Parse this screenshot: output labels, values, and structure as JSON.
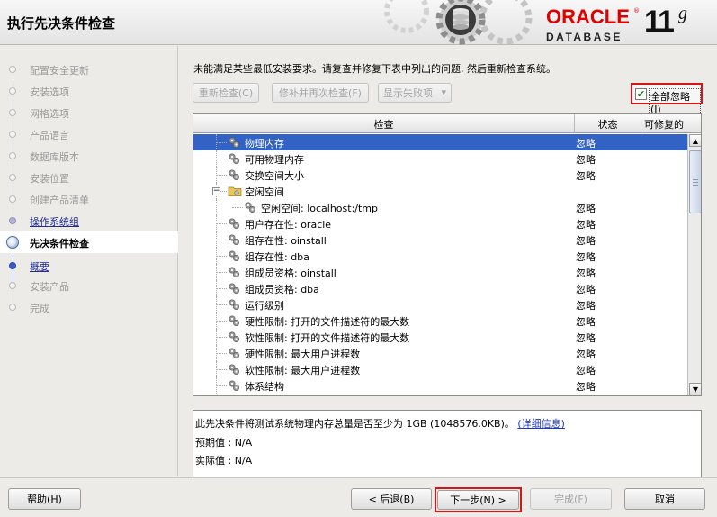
{
  "window": {
    "title": "执行先决条件检查"
  },
  "branding": {
    "oracle": "ORACLE",
    "registered": "®",
    "database": "DATABASE",
    "version": "11",
    "version_suffix": "g"
  },
  "sidebar": {
    "steps": [
      {
        "label": "配置安全更新",
        "state": "pending"
      },
      {
        "label": "安装选项",
        "state": "pending"
      },
      {
        "label": "网格选项",
        "state": "pending"
      },
      {
        "label": "产品语言",
        "state": "pending"
      },
      {
        "label": "数据库版本",
        "state": "pending"
      },
      {
        "label": "安装位置",
        "state": "pending"
      },
      {
        "label": "创建产品清单",
        "state": "pending"
      },
      {
        "label": "操作系统组",
        "state": "done"
      },
      {
        "label": "先决条件检查",
        "state": "current"
      },
      {
        "label": "概要",
        "state": "next"
      },
      {
        "label": "安装产品",
        "state": "pending"
      },
      {
        "label": "完成",
        "state": "pending"
      }
    ]
  },
  "main": {
    "instruction": "未能满足某些最低安装要求。请复查并修复下表中列出的问题, 然后重新检查系统。",
    "toolbar": {
      "recheck": "重新检查(C)",
      "fix_and_check": "修补并再次检查(F)",
      "show_failed": "显示失败项",
      "dropdown_arrow": "▾"
    },
    "ignore_all": {
      "label": "全部忽略(I)",
      "checked": true,
      "checkmark": "✔"
    },
    "table": {
      "columns": [
        "检查",
        "状态",
        "可修复的"
      ],
      "rows": [
        {
          "label": "物理内存",
          "status": "忽略",
          "level": 1,
          "icon": "gear-icon",
          "selected": true
        },
        {
          "label": "可用物理内存",
          "status": "忽略",
          "level": 1,
          "icon": "gear-icon"
        },
        {
          "label": "交换空间大小",
          "status": "忽略",
          "level": 1,
          "icon": "gear-icon"
        },
        {
          "label": "空闲空间",
          "status": "",
          "level": 1,
          "icon": "folder-icon",
          "expanded": true
        },
        {
          "label": "空闲空间: localhost:/tmp",
          "status": "忽略",
          "level": 2,
          "icon": "gear-icon"
        },
        {
          "label": "用户存在性: oracle",
          "status": "忽略",
          "level": 1,
          "icon": "gear-icon"
        },
        {
          "label": "组存在性: oinstall",
          "status": "忽略",
          "level": 1,
          "icon": "gear-icon"
        },
        {
          "label": "组存在性: dba",
          "status": "忽略",
          "level": 1,
          "icon": "gear-icon"
        },
        {
          "label": "组成员资格: oinstall",
          "status": "忽略",
          "level": 1,
          "icon": "gear-icon"
        },
        {
          "label": "组成员资格: dba",
          "status": "忽略",
          "level": 1,
          "icon": "gear-icon"
        },
        {
          "label": "运行级别",
          "status": "忽略",
          "level": 1,
          "icon": "gear-icon"
        },
        {
          "label": "硬性限制: 打开的文件描述符的最大数",
          "status": "忽略",
          "level": 1,
          "icon": "gear-icon"
        },
        {
          "label": "软性限制: 打开的文件描述符的最大数",
          "status": "忽略",
          "level": 1,
          "icon": "gear-icon"
        },
        {
          "label": "硬性限制: 最大用户进程数",
          "status": "忽略",
          "level": 1,
          "icon": "gear-icon"
        },
        {
          "label": "软性限制: 最大用户进程数",
          "status": "忽略",
          "level": 1,
          "icon": "gear-icon"
        },
        {
          "label": "体系结构",
          "status": "忽略",
          "level": 1,
          "icon": "gear-icon"
        }
      ]
    },
    "details": {
      "description": "此先决条件将测试系统物理内存总量是否至少为 1GB (1048576.0KB)。",
      "more_link": "(详细信息)",
      "expected": "预期值 : N/A",
      "actual": "实际值 : N/A"
    }
  },
  "footer": {
    "help": "帮助(H)",
    "back": "< 后退(B)",
    "next": "下一步(N) >",
    "finish": "完成(F)",
    "cancel": "取消"
  }
}
